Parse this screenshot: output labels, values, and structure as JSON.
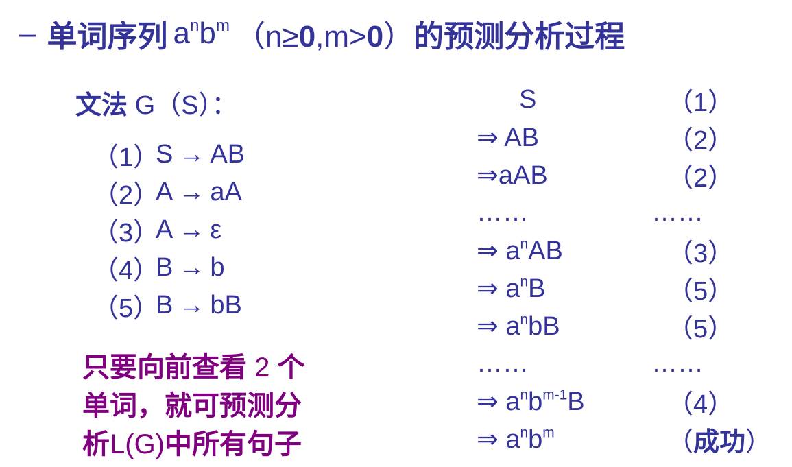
{
  "title": {
    "dash": "–",
    "prefix": "单词序列",
    "formula_base_a": "a",
    "formula_sup_n": "n",
    "formula_base_b": "b",
    "formula_sup_m": "m",
    "cond_open": "（n≥",
    "cond_zero1": "0",
    "cond_mid": ",m>",
    "cond_zero2": "0",
    "cond_close": "）",
    "suffix": "的预测分析过程"
  },
  "grammar": {
    "title_bold": "文法",
    "title_rest": " G（S）："
  },
  "rules": [
    {
      "num": "（1）",
      "lhs": "S",
      "arrow": "→",
      "rhs": "AB"
    },
    {
      "num": "（2）",
      "lhs": "A",
      "arrow": "→",
      "rhs": "aA"
    },
    {
      "num": "（3）",
      "lhs": "A",
      "arrow": "→",
      "rhs": "ε"
    },
    {
      "num": "（4）",
      "lhs": "B",
      "arrow": "→",
      "rhs": "b"
    },
    {
      "num": "（5）",
      "lhs": "B",
      "arrow": "→",
      "rhs": "bB"
    }
  ],
  "note": {
    "line1_a": "只要向前查看 ",
    "line1_num": "2",
    "line1_b": " 个",
    "line2": "单词，就可预测分",
    "line3_a": "析",
    "line3_lat": "L(G)",
    "line3_b": "中所有句子"
  },
  "derivation": [
    {
      "form": "S",
      "rule": "（1）"
    },
    {
      "form": "⇒ AB",
      "rule": "（2）"
    },
    {
      "form": "⇒aAB",
      "rule": "（2）"
    },
    {
      "form": "……",
      "rule": "……"
    },
    {
      "form_pre": "⇒ a",
      "sup": "n",
      "form_post": "AB",
      "rule": "（3）"
    },
    {
      "form_pre": "⇒ a",
      "sup": "n",
      "form_post": "B",
      "rule": "（5）"
    },
    {
      "form_pre": "⇒ a",
      "sup": "n",
      "form_post": "bB",
      "rule": "（5）"
    },
    {
      "form": "……",
      "rule": "……"
    },
    {
      "form_pre": "⇒ a",
      "sup": "n",
      "form_mid": "b",
      "sup2": "m-1",
      "form_post": "B",
      "rule": "（4）"
    },
    {
      "form_pre": "⇒ a",
      "sup": "n",
      "form_mid": "b",
      "sup2": "m",
      "form_post": "",
      "rule_open": "（",
      "rule_bold": "成功",
      "rule_close": "）"
    }
  ]
}
